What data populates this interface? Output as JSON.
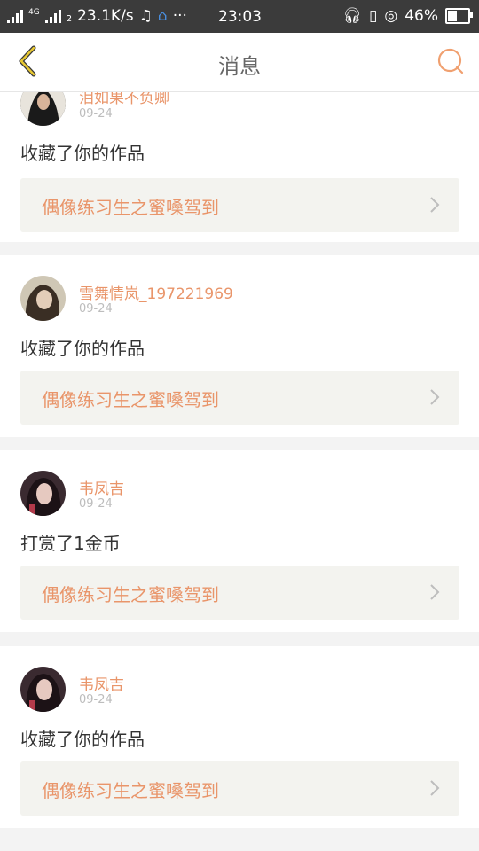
{
  "status_bar": {
    "network": "4G",
    "sim": "2",
    "speed": "23.1K/s",
    "time": "23:03",
    "battery": "46%",
    "battery_level": 0.46
  },
  "header": {
    "title": "消息"
  },
  "notifications": [
    {
      "user": "泪如果不负卿",
      "date": "09-24",
      "action": "收藏了你的作品",
      "work": "偶像练习生之蜜嗓驾到"
    },
    {
      "user": "雪舞情岚_197221969",
      "date": "09-24",
      "action": "收藏了你的作品",
      "work": "偶像练习生之蜜嗓驾到"
    },
    {
      "user": "韦凤吉",
      "date": "09-24",
      "action": "打赏了1金币",
      "work": "偶像练习生之蜜嗓驾到"
    },
    {
      "user": "韦凤吉",
      "date": "09-24",
      "action": "收藏了你的作品",
      "work": "偶像练习生之蜜嗓驾到"
    }
  ]
}
